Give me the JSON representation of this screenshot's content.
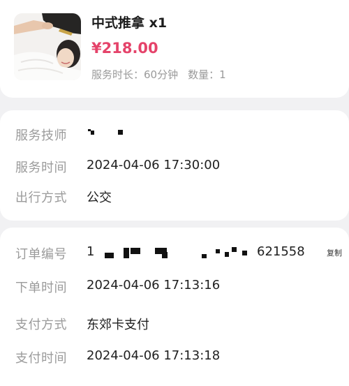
{
  "product": {
    "title": "中式推拿 x1",
    "price": "¥218.00",
    "duration_label": "服务时长：",
    "duration_value": "60分钟",
    "quantity_label": "数量：",
    "quantity_value": "1"
  },
  "service": {
    "technician_label": "服务技师",
    "technician_value": "",
    "time_label": "服务时间",
    "time_value": "2024-04-06 17:30:00",
    "travel_label": "出行方式",
    "travel_value": "公交"
  },
  "order": {
    "number_label": "订单编号",
    "number_prefix": "1",
    "number_suffix": "621558",
    "copy_label": "复制",
    "placed_label": "下单时间",
    "placed_value": "2024-04-06 17:13:16",
    "payment_label": "支付方式",
    "payment_value": "东郊卡支付",
    "paid_label": "支付时间",
    "paid_value": "2024-04-06 17:13:18"
  },
  "colors": {
    "price": "#e5436a",
    "background": "#f1f1f3"
  }
}
